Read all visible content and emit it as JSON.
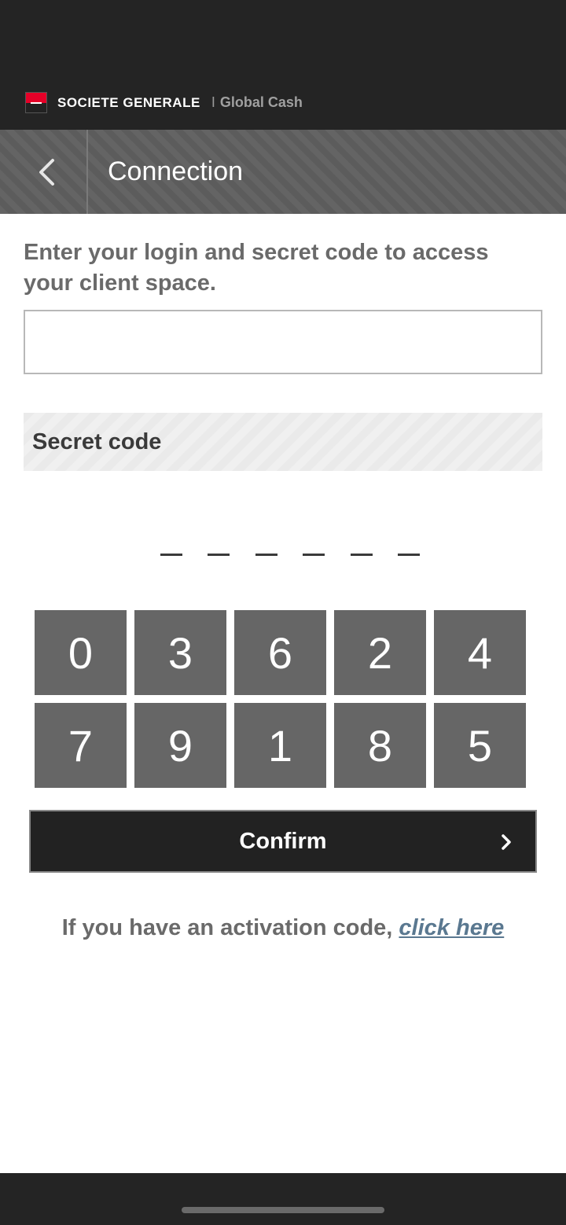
{
  "header": {
    "brand_name": "SOCIETE GENERALE",
    "separator": "I",
    "product": "Global Cash"
  },
  "nav": {
    "title": "Connection",
    "back_icon": "chevron-left-icon"
  },
  "login": {
    "instruction": "Enter your login and secret code to access your client space.",
    "value": "",
    "placeholder": ""
  },
  "secret": {
    "header": "Secret code",
    "slot_count": 6
  },
  "keypad": {
    "keys": [
      "0",
      "3",
      "6",
      "2",
      "4",
      "7",
      "9",
      "1",
      "8",
      "5"
    ]
  },
  "confirm": {
    "label": "Confirm",
    "arrow_icon": "chevron-right-icon"
  },
  "activation": {
    "text": "If you have an activation code, ",
    "link": "click here"
  },
  "colors": {
    "brand_red": "#e60028",
    "header_bg": "#242424",
    "key_bg": "#666666",
    "link": "#5a7890"
  }
}
